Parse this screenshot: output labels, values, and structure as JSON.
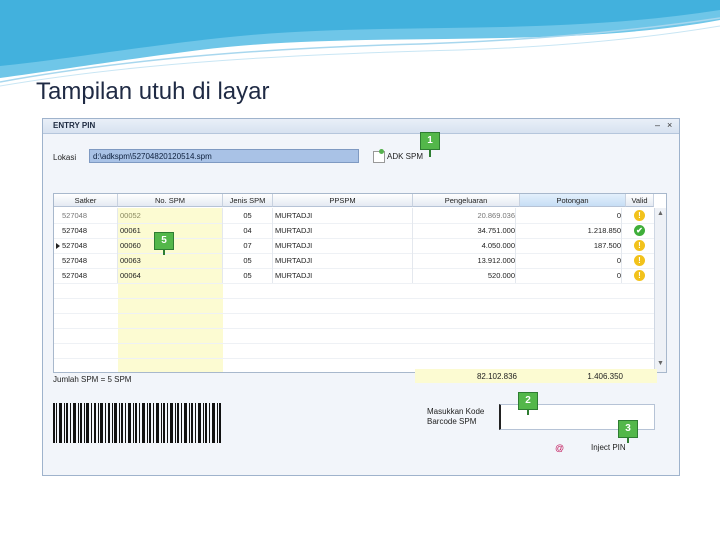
{
  "slide": {
    "title": "Tampilan utuh di layar"
  },
  "window": {
    "title": "ENTRY PIN",
    "minimize": "–",
    "close": "×",
    "lokasi_label": "Lokasi",
    "lokasi_value": "d:\\adkspm\\52704820120514.spm",
    "adk_button": "ADK SPM"
  },
  "table": {
    "columns": [
      "Satker",
      "No. SPM",
      "Jenis SPM",
      "PPSPM",
      "Pengeluaran",
      "Potongan",
      "Valid"
    ],
    "rows": [
      {
        "satker": "527048",
        "no_spm": "00052",
        "jenis": "05",
        "ppspm": "MURTADJI",
        "pengeluaran": "20.869.036",
        "potongan": "0",
        "valid": "warning"
      },
      {
        "satker": "527048",
        "no_spm": "00061",
        "jenis": "04",
        "ppspm": "MURTADJI",
        "pengeluaran": "34.751.000",
        "potongan": "1.218.850",
        "valid": "ok"
      },
      {
        "satker": "527048",
        "no_spm": "00060",
        "jenis": "07",
        "ppspm": "MURTADJI",
        "pengeluaran": "4.050.000",
        "potongan": "187.500",
        "valid": "warning"
      },
      {
        "satker": "527048",
        "no_spm": "00063",
        "jenis": "05",
        "ppspm": "MURTADJI",
        "pengeluaran": "13.912.000",
        "potongan": "0",
        "valid": "warning"
      },
      {
        "satker": "527048",
        "no_spm": "00064",
        "jenis": "05",
        "ppspm": "MURTADJI",
        "pengeluaran": "520.000",
        "potongan": "0",
        "valid": "warning"
      }
    ],
    "valid_icons": {
      "warning": "!",
      "ok": "✔"
    }
  },
  "footer": {
    "jumlah_label": "Jumlah SPM = 5 SPM",
    "total_pengeluaran": "82.102.836",
    "total_potongan": "1.406.350",
    "masukkan_label_1": "Masukkan Kode",
    "masukkan_label_2": "Barcode SPM",
    "inject_label": "Inject PIN"
  },
  "callouts": [
    "1",
    "2",
    "3",
    "5"
  ],
  "colors": {
    "callout": "#53b74a",
    "accent": "#a9c2e6",
    "highlight": "#fcfbd2"
  }
}
